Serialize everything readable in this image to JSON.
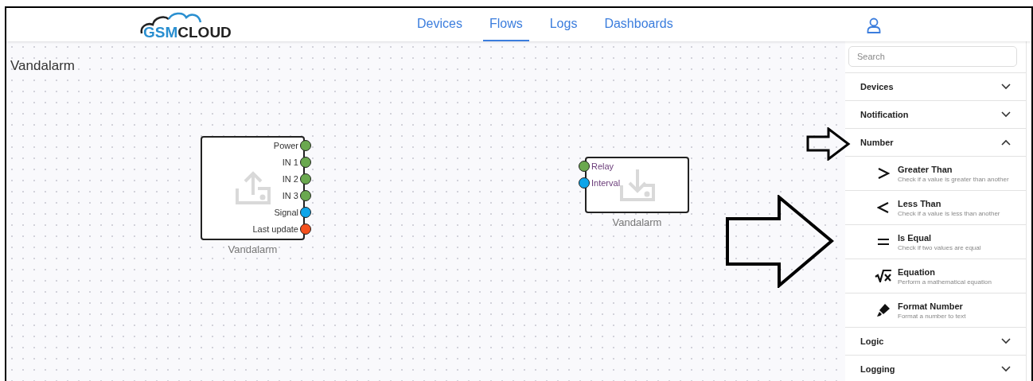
{
  "logo": {
    "part_1": "GSM",
    "part_2": "CLOUD"
  },
  "nav": [
    {
      "label": "Devices",
      "selected": false
    },
    {
      "label": "Flows",
      "selected": true
    },
    {
      "label": "Logs",
      "selected": false
    },
    {
      "label": "Dashboards",
      "selected": false
    }
  ],
  "canvas": {
    "title": "Vandalarm",
    "nodes": [
      {
        "kind": "output",
        "name": "Vandalarm",
        "ports": [
          {
            "label": "Power",
            "color": "#6aa84f"
          },
          {
            "label": "IN 1",
            "color": "#6aa84f"
          },
          {
            "label": "IN 2",
            "color": "#6aa84f"
          },
          {
            "label": "IN 3",
            "color": "#6aa84f"
          },
          {
            "label": "Signal",
            "color": "#0ea5e9"
          },
          {
            "label": "Last update",
            "color": "#f4511e"
          }
        ]
      },
      {
        "kind": "input",
        "name": "Vandalarm",
        "ports": [
          {
            "label": "Relay",
            "color": "#6aa84f"
          },
          {
            "label": "Interval",
            "color": "#0ea5e9"
          }
        ]
      }
    ]
  },
  "sidebar": {
    "search": {
      "placeholder": "Search"
    },
    "categories": [
      {
        "label": "Devices",
        "expanded": false
      },
      {
        "label": "Notification",
        "expanded": false
      },
      {
        "label": "Number",
        "expanded": true,
        "children": [
          {
            "title": "Greater Than",
            "description": "Check if a value is greater than another"
          },
          {
            "title": "Less Than",
            "description": "Check if a value is less than another"
          },
          {
            "title": "Is Equal",
            "description": "Check if two values are equal"
          },
          {
            "title": "Equation",
            "description": "Perform a mathematical equation"
          },
          {
            "title": "Format Number",
            "description": "Format a number to text"
          }
        ]
      },
      {
        "label": "Logic",
        "expanded": false
      },
      {
        "label": "Logging",
        "expanded": false
      }
    ]
  }
}
